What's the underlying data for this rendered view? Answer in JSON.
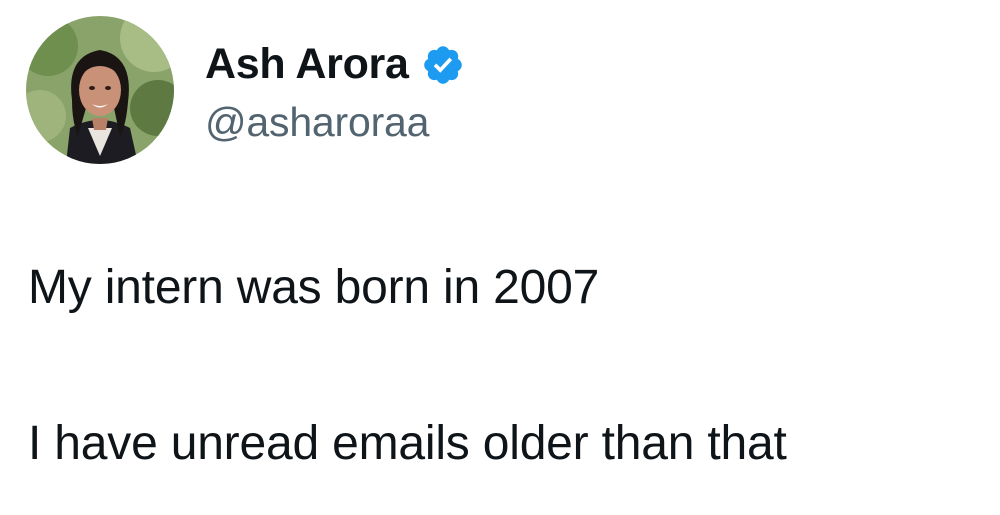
{
  "author": {
    "display_name": "Ash Arora",
    "handle": "@asharoraa",
    "verified_icon": "verified-badge-icon",
    "badge_color": "#1d9bf0",
    "avatar_icon": "profile-photo"
  },
  "tweet": {
    "lines": [
      "My intern was born in 2007",
      "I have unread emails older than that"
    ]
  }
}
